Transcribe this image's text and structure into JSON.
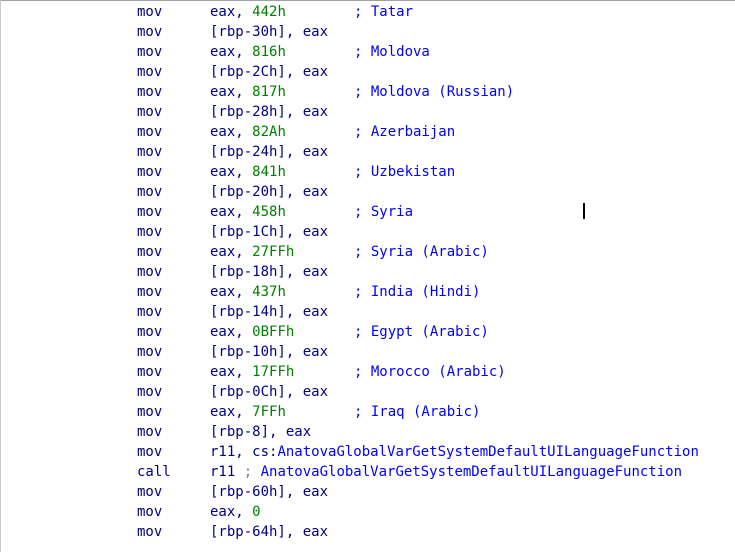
{
  "lines": [
    {
      "mnemonic": "mov",
      "dest": "eax, ",
      "value": "442h",
      "comment": "; Tatar"
    },
    {
      "mnemonic": "mov",
      "dest": "[rbp-30h], eax"
    },
    {
      "mnemonic": "mov",
      "dest": "eax, ",
      "value": "816h",
      "comment": "; Moldova"
    },
    {
      "mnemonic": "mov",
      "dest": "[rbp-2Ch], eax"
    },
    {
      "mnemonic": "mov",
      "dest": "eax, ",
      "value": "817h",
      "comment": "; Moldova (Russian)"
    },
    {
      "mnemonic": "mov",
      "dest": "[rbp-28h], eax"
    },
    {
      "mnemonic": "mov",
      "dest": "eax, ",
      "value": "82Ah",
      "comment": "; Azerbaijan"
    },
    {
      "mnemonic": "mov",
      "dest": "[rbp-24h], eax"
    },
    {
      "mnemonic": "mov",
      "dest": "eax, ",
      "value": "841h",
      "comment": "; Uzbekistan"
    },
    {
      "mnemonic": "mov",
      "dest": "[rbp-20h], eax"
    },
    {
      "mnemonic": "mov",
      "dest": "eax, ",
      "value": "458h",
      "comment": "; Syria"
    },
    {
      "mnemonic": "mov",
      "dest": "[rbp-1Ch], eax"
    },
    {
      "mnemonic": "mov",
      "dest": "eax, ",
      "value": "27FFh",
      "comment": "; Syria (Arabic)"
    },
    {
      "mnemonic": "mov",
      "dest": "[rbp-18h], eax"
    },
    {
      "mnemonic": "mov",
      "dest": "eax, ",
      "value": "437h",
      "comment": "; India (Hindi)"
    },
    {
      "mnemonic": "mov",
      "dest": "[rbp-14h], eax"
    },
    {
      "mnemonic": "mov",
      "dest": "eax, ",
      "value": "0BFFh",
      "comment": "; Egypt (Arabic)"
    },
    {
      "mnemonic": "mov",
      "dest": "[rbp-10h], eax"
    },
    {
      "mnemonic": "mov",
      "dest": "eax, ",
      "value": "17FFh",
      "comment": "; Morocco (Arabic)"
    },
    {
      "mnemonic": "mov",
      "dest": "[rbp-0Ch], eax"
    },
    {
      "mnemonic": "mov",
      "dest": "eax, ",
      "value": "7FFh",
      "comment": "; Iraq (Arabic)"
    },
    {
      "mnemonic": "mov",
      "dest": "[rbp-8], eax"
    },
    {
      "mnemonic": "mov",
      "dest": "r11, cs:",
      "symbol": "AnatovaGlobalVarGetSystemDefaultUILanguageFunction"
    },
    {
      "mnemonic": "call",
      "dest": "r11 ",
      "sep": ";",
      "symbol": " AnatovaGlobalVarGetSystemDefaultUILanguageFunction"
    },
    {
      "mnemonic": "mov",
      "dest": "[rbp-60h], eax"
    },
    {
      "mnemonic": "mov",
      "dest": "eax, ",
      "value": "0"
    },
    {
      "mnemonic": "mov",
      "dest": "[rbp-64h], eax"
    }
  ],
  "colors": {
    "instruction": "#000080",
    "number": "#008000",
    "comment": "#0000ff",
    "symbol": "#0000ff",
    "separator": "#808080"
  }
}
